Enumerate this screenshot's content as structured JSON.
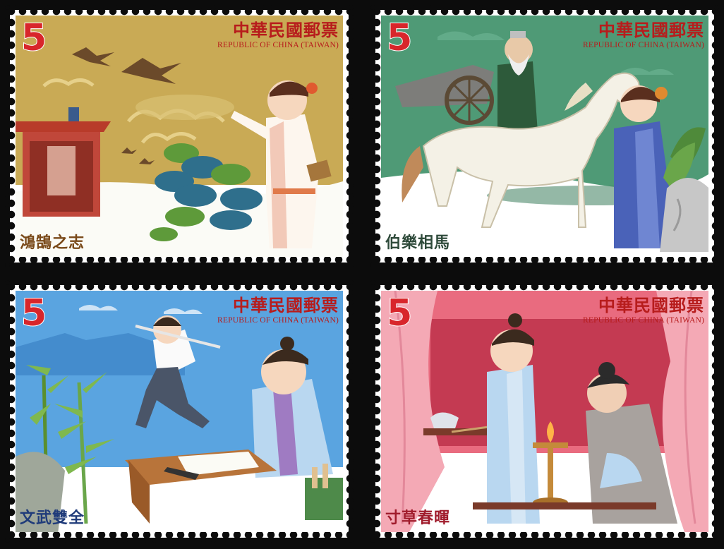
{
  "stamps": [
    {
      "id": "s1",
      "denomination": "5",
      "country_cn": "中華民國郵票",
      "country_en": "REPUBLIC OF CHINA (TAIWAN)",
      "caption": "鴻鵠之志",
      "caption_color": "#7a4a1a",
      "bg_color": "#c9aa55"
    },
    {
      "id": "s2",
      "denomination": "5",
      "country_cn": "中華民國郵票",
      "country_en": "REPUBLIC OF CHINA (TAIWAN)",
      "caption": "伯樂相馬",
      "caption_color": "#2e4a3a",
      "bg_color": "#4f9a76"
    },
    {
      "id": "s3",
      "denomination": "5",
      "country_cn": "中華民國郵票",
      "country_en": "REPUBLIC OF CHINA (TAIWAN)",
      "caption": "文武雙全",
      "caption_color": "#1f3b7a",
      "bg_color": "#5aa4e0"
    },
    {
      "id": "s4",
      "denomination": "5",
      "country_cn": "中華民國郵票",
      "country_en": "REPUBLIC OF CHINA (TAIWAN)",
      "caption": "寸草春暉",
      "caption_color": "#a01c2c",
      "bg_color": "#e96b7f"
    }
  ]
}
